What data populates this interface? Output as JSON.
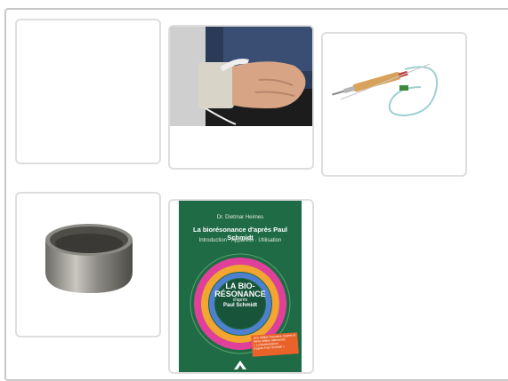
{
  "gallery": {
    "items": [
      {
        "name": "empty-product"
      },
      {
        "name": "wrist-electrode-photo"
      },
      {
        "name": "pen-probe-photo"
      },
      {
        "name": "metal-cup-photo"
      },
      {
        "name": "book-cover",
        "book": {
          "author": "Dr. Dietmar Heimes",
          "title": "La biorésonance d'après Paul Schmidt",
          "subtitle": "Introduction · Appareils · Utilisation",
          "center_line1": "LA BIO-",
          "center_line2": "RÉSONANCE",
          "center_line3": "d'après",
          "center_line4": "Paul Schmidt",
          "sticker_line1": "1ère édition française d'après la",
          "sticker_line2": "4ème édition allemande",
          "sticker_line3": "« La biorésonance",
          "sticker_line4": "d'après Paul Schmidt »"
        }
      }
    ]
  },
  "colors": {
    "book_green": "#1f6b45",
    "book_dark": "#17543a",
    "sticker": "#e8622a",
    "card_border": "#dedede",
    "panel_border": "#c8c8c8"
  }
}
